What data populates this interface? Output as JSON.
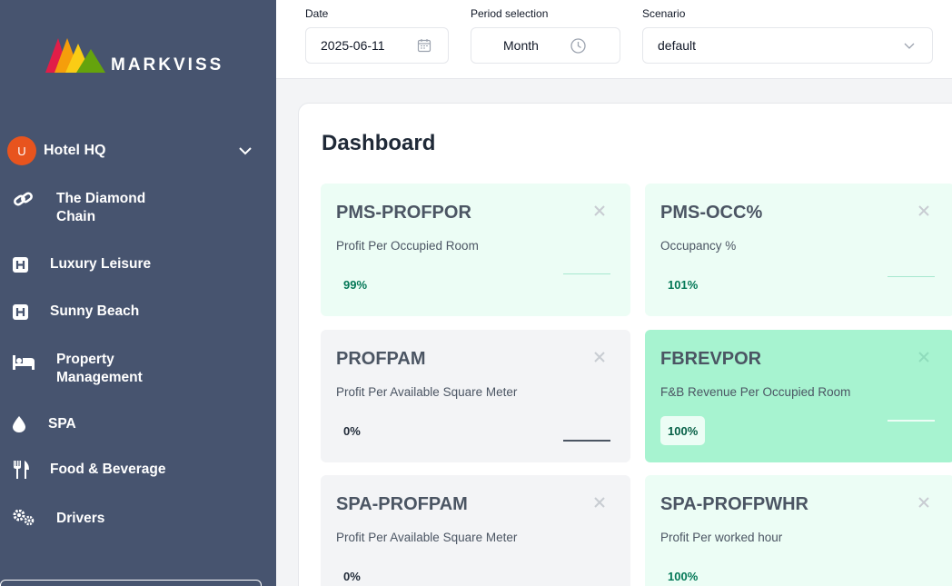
{
  "brand": {
    "name": "MARKVISS"
  },
  "sidebar": {
    "org": {
      "avatar_initial": "U",
      "label": "Hotel HQ"
    },
    "items": [
      {
        "label_line1": "The Diamond",
        "label_line2": "Chain",
        "icon": "link-icon"
      },
      {
        "label_line1": "Luxury Leisure",
        "label_line2": "",
        "icon": "hotel-icon"
      },
      {
        "label_line1": "Sunny Beach",
        "label_line2": "",
        "icon": "hotel-icon"
      },
      {
        "label_line1": "Property",
        "label_line2": "Management",
        "icon": "bed-icon"
      },
      {
        "label_line1": "SPA",
        "label_line2": "",
        "icon": "drop-icon"
      },
      {
        "label_line1": "Food & Beverage",
        "label_line2": "",
        "icon": "utensils-icon"
      },
      {
        "label_line1": "Drivers",
        "label_line2": "",
        "icon": "gears-icon"
      }
    ]
  },
  "filters": {
    "date": {
      "label": "Date",
      "value": "2025-06-11"
    },
    "period": {
      "label": "Period selection",
      "value": "Month"
    },
    "scenario": {
      "label": "Scenario",
      "value": "default"
    }
  },
  "dashboard": {
    "title": "Dashboard",
    "cards": [
      {
        "code": "PMS-PROFPOR",
        "description": "Profit Per Occupied Room",
        "value": "99%",
        "status": "light-green"
      },
      {
        "code": "PMS-OCC%",
        "description": "Occupancy %",
        "value": "101%",
        "status": "light-green"
      },
      {
        "code": "PROFPAM",
        "description": "Profit Per Available Square Meter",
        "value": "0%",
        "status": "gray"
      },
      {
        "code": "FBREVPOR",
        "description": "F&B Revenue Per Occupied Room",
        "value": "100%",
        "status": "green"
      },
      {
        "code": "SPA-PROFPAM",
        "description": "Profit Per Available Square Meter",
        "value": "0%",
        "status": "gray"
      },
      {
        "code": "SPA-PROFPWHR",
        "description": "Profit Per worked hour",
        "value": "100%",
        "status": "light-green"
      }
    ]
  },
  "colors": {
    "sidebar_bg": "#47546f",
    "avatar": "#e8541e",
    "card_light_green": "#ecfdf5",
    "card_green": "#a7f3d0",
    "card_gray": "#f3f4f6"
  }
}
